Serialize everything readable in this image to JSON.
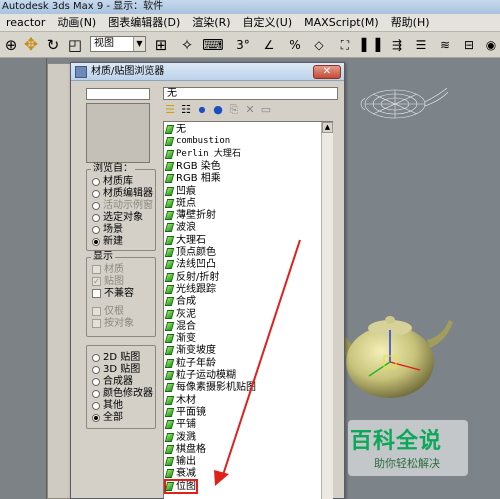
{
  "window": {
    "title": "Autodesk 3ds Max 9   - 显示：软件"
  },
  "menu": {
    "items": [
      "reactor",
      "动画(N)",
      "图表编辑器(D)",
      "渲染(R)",
      "自定义(U)",
      "MAXScript(M)",
      "帮助(H)"
    ]
  },
  "toolbar": {
    "view_dropdown": "视图"
  },
  "browser": {
    "title": "材质/贴图浏览器",
    "name_value": "无",
    "browse_from": {
      "label": "浏览自：",
      "options": [
        {
          "label": "材质库",
          "state": "off"
        },
        {
          "label": "材质编辑器",
          "state": "off"
        },
        {
          "label": "活动示例窗",
          "state": "disabled"
        },
        {
          "label": "选定对象",
          "state": "off"
        },
        {
          "label": "场景",
          "state": "off"
        },
        {
          "label": "新建",
          "state": "on"
        }
      ]
    },
    "show": {
      "label": "显示",
      "options": [
        {
          "label": "材质",
          "checked": false,
          "disabled": true
        },
        {
          "label": "贴图",
          "checked": true,
          "disabled": true
        },
        {
          "label": "不兼容",
          "checked": false,
          "disabled": false
        }
      ],
      "extra": [
        {
          "label": "仅根",
          "disabled": true
        },
        {
          "label": "按对象",
          "disabled": true
        }
      ]
    },
    "map_type": {
      "options": [
        {
          "label": "2D 贴图",
          "state": "off"
        },
        {
          "label": "3D 贴图",
          "state": "off"
        },
        {
          "label": "合成器",
          "state": "off"
        },
        {
          "label": "颜色修改器",
          "state": "off"
        },
        {
          "label": "其他",
          "state": "off"
        },
        {
          "label": "全部",
          "state": "on"
        }
      ]
    },
    "list": [
      {
        "label": "无"
      },
      {
        "label": "combustion",
        "mono": true
      },
      {
        "label": "Perlin 大理石",
        "mono": true
      },
      {
        "label": "RGB 染色"
      },
      {
        "label": "RGB 相乘"
      },
      {
        "label": "凹痕"
      },
      {
        "label": "斑点"
      },
      {
        "label": "薄壁折射"
      },
      {
        "label": "波浪"
      },
      {
        "label": "大理石"
      },
      {
        "label": "顶点颜色"
      },
      {
        "label": "法线凹凸"
      },
      {
        "label": "反射/折射"
      },
      {
        "label": "光线跟踪"
      },
      {
        "label": "合成"
      },
      {
        "label": "灰泥"
      },
      {
        "label": "混合"
      },
      {
        "label": "渐变"
      },
      {
        "label": "渐变坡度"
      },
      {
        "label": "粒子年龄"
      },
      {
        "label": "粒子运动模糊"
      },
      {
        "label": "每像素摄影机贴图"
      },
      {
        "label": "木材"
      },
      {
        "label": "平面镜"
      },
      {
        "label": "平铺"
      },
      {
        "label": "泼溅"
      },
      {
        "label": "棋盘格"
      },
      {
        "label": "输出"
      },
      {
        "label": "衰减"
      },
      {
        "label": "位图",
        "selected": true
      }
    ]
  },
  "watermark": {
    "title": "百科全说",
    "subtitle": "助你轻松解决"
  }
}
